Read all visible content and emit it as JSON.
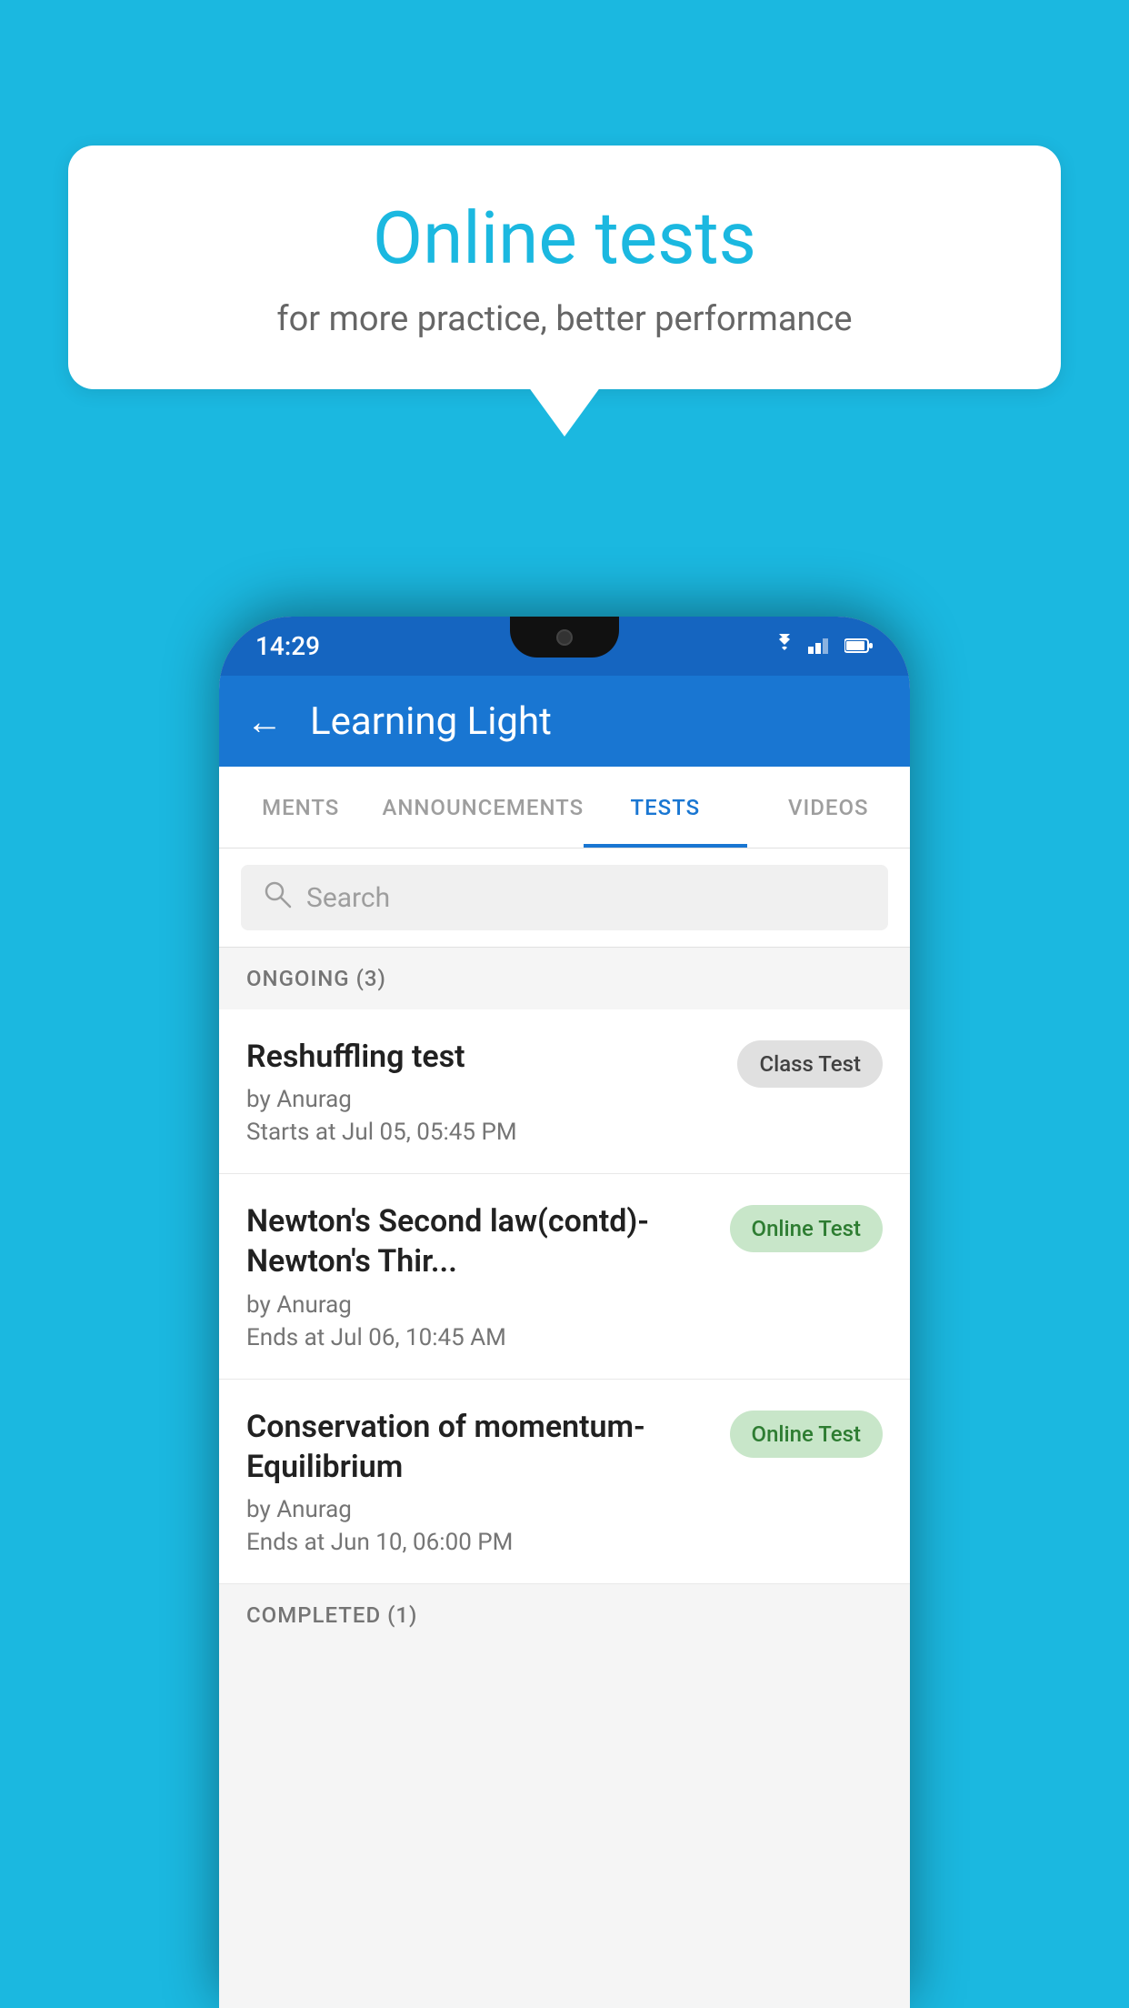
{
  "background": {
    "color": "#1BB8E0"
  },
  "speech_bubble": {
    "title": "Online tests",
    "subtitle": "for more practice, better performance"
  },
  "status_bar": {
    "time": "14:29",
    "wifi_icon": "▼",
    "signal_icon": "◂",
    "battery_icon": "▮"
  },
  "app_bar": {
    "back_label": "←",
    "title": "Learning Light"
  },
  "tabs": [
    {
      "label": "MENTS",
      "active": false
    },
    {
      "label": "ANNOUNCEMENTS",
      "active": false
    },
    {
      "label": "TESTS",
      "active": true
    },
    {
      "label": "VIDEOS",
      "active": false
    }
  ],
  "search": {
    "placeholder": "Search"
  },
  "ongoing_section": {
    "title": "ONGOING (3)"
  },
  "tests": [
    {
      "name": "Reshuffling test",
      "author": "by Anurag",
      "time_label": "Starts at",
      "time": "Jul 05, 05:45 PM",
      "badge": "Class Test",
      "badge_type": "class"
    },
    {
      "name": "Newton's Second law(contd)-Newton's Thir...",
      "author": "by Anurag",
      "time_label": "Ends at",
      "time": "Jul 06, 10:45 AM",
      "badge": "Online Test",
      "badge_type": "online"
    },
    {
      "name": "Conservation of momentum-Equilibrium",
      "author": "by Anurag",
      "time_label": "Ends at",
      "time": "Jun 10, 06:00 PM",
      "badge": "Online Test",
      "badge_type": "online"
    }
  ],
  "completed_section": {
    "title": "COMPLETED (1)"
  }
}
